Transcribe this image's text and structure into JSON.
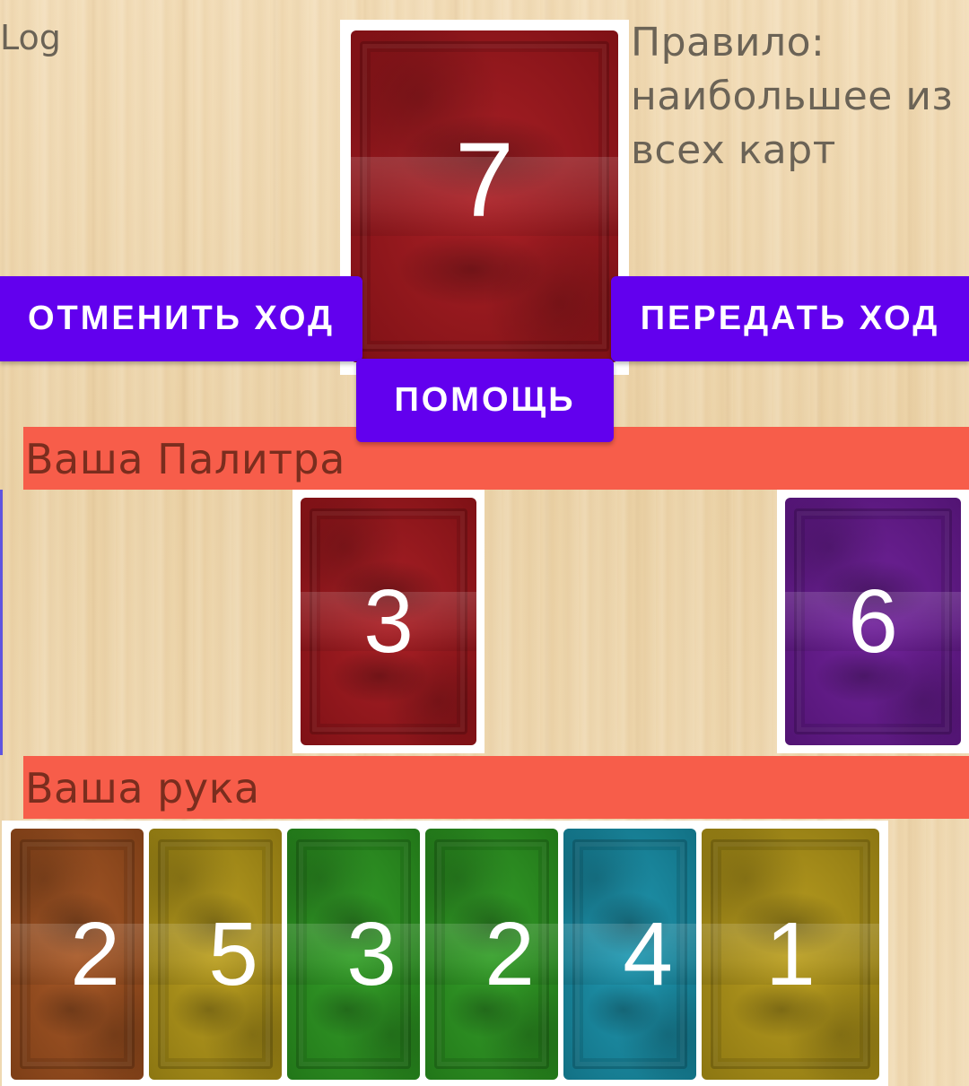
{
  "log": {
    "label": "Log"
  },
  "rule": {
    "text": "Правило: наибольшее из всех карт"
  },
  "top_card": {
    "value": "7",
    "color": "#a5141a"
  },
  "buttons": {
    "undo": "ОТМЕНИТЬ ХОД",
    "pass": "ПЕРЕДАТЬ ХОД",
    "help": "ПОМОЩЬ",
    "color": "#6200ee"
  },
  "palette": {
    "title": "Ваша Палитра",
    "cards": [
      {
        "value": "3",
        "color": "#a5141a"
      },
      {
        "value": "6",
        "color": "#6a1896"
      }
    ]
  },
  "hand": {
    "title": "Ваша рука",
    "cards": [
      {
        "value": "2",
        "color": "#a3501c"
      },
      {
        "value": "5",
        "color": "#b79a15"
      },
      {
        "value": "3",
        "color": "#2a9a1e"
      },
      {
        "value": "2",
        "color": "#2a9a1e"
      },
      {
        "value": "4",
        "color": "#1593ad"
      },
      {
        "value": "1",
        "color": "#b79a15"
      }
    ]
  },
  "colors": {
    "section_header": "#f75d4a",
    "table": "#f0d9b2"
  }
}
